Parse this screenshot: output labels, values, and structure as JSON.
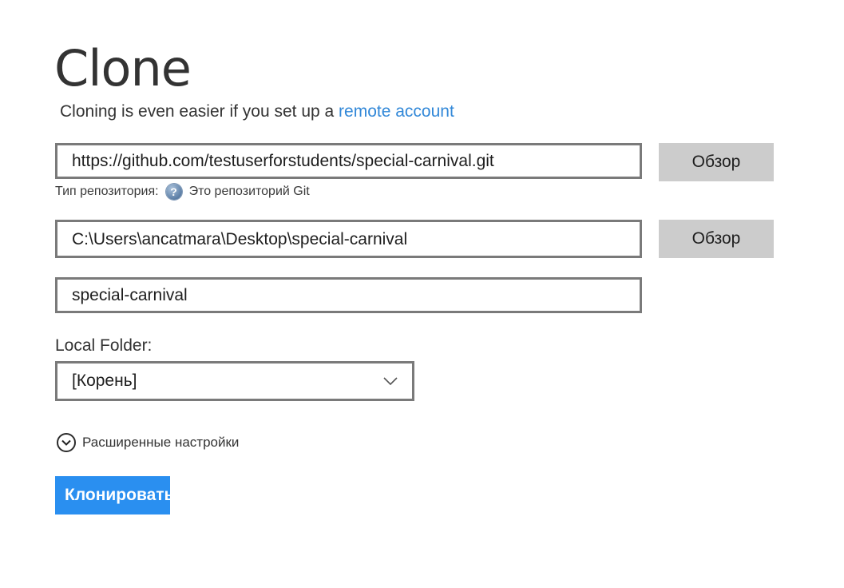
{
  "header": {
    "title": "Clone",
    "subtitle_prefix": "Cloning is even easier if you set up a",
    "subtitle_link": "remote account"
  },
  "form": {
    "repo_url": {
      "value": "https://github.com/testuserforstudents/special-carnival.git"
    },
    "browse_label": "Обзор",
    "repo_type": {
      "label": "Тип репозитория:",
      "value": "Это репозиторий Git",
      "icon": "help-icon"
    },
    "local_path": {
      "value": "C:\\Users\\ancatmara\\Desktop\\special-carnival"
    },
    "repo_name": {
      "value": "special-carnival"
    },
    "local_folder": {
      "label": "Local Folder:",
      "selected": "[Корень]"
    },
    "advanced": {
      "label": "Расширенные настройки"
    },
    "clone_button": "Клонировать"
  },
  "colors": {
    "link": "#3288d8",
    "primary_button": "#2a8ff0",
    "secondary_button": "#cccccc",
    "field_border": "#7a7a7a"
  }
}
